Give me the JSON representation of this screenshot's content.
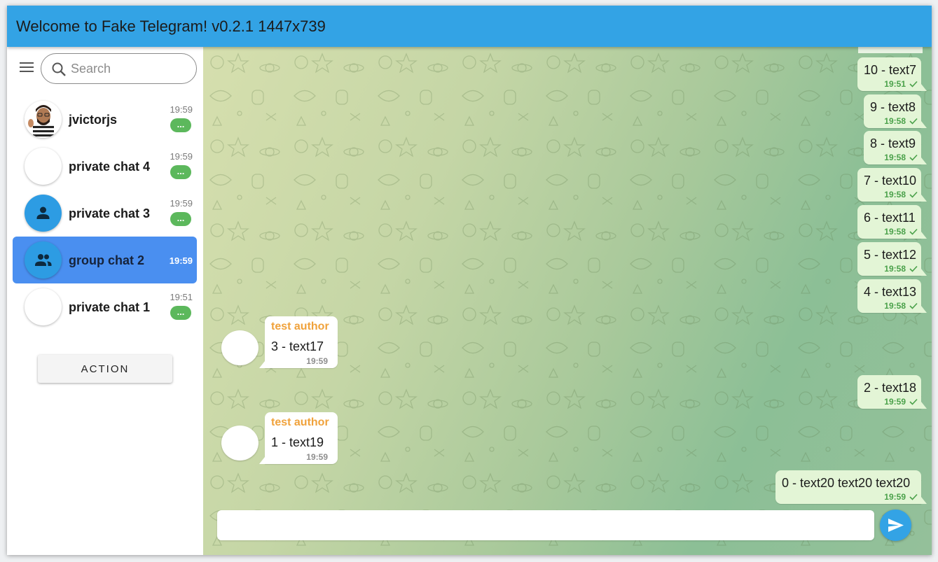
{
  "window": {
    "title": "Welcome to Fake Telegram! v0.2.1 1447x739"
  },
  "sidebar": {
    "menu_icon": "hamburger-menu-icon",
    "search": {
      "placeholder": "Search",
      "value": ""
    },
    "chats": [
      {
        "name": "jvictorjs",
        "time": "19:59",
        "badge": "...",
        "avatar": "photo",
        "active": false
      },
      {
        "name": "private chat 4",
        "time": "19:59",
        "badge": "...",
        "avatar": "blank",
        "active": false
      },
      {
        "name": "private chat 3",
        "time": "19:59",
        "badge": "...",
        "avatar": "person-icon",
        "active": false
      },
      {
        "name": "group chat 2",
        "time": "19:59",
        "badge": "",
        "avatar": "group-icon",
        "active": true
      },
      {
        "name": "private chat 1",
        "time": "19:51",
        "badge": "...",
        "avatar": "blank",
        "active": false
      }
    ],
    "action_button": "ACTION"
  },
  "messages": {
    "outgoing": [
      {
        "text": "10 - text7",
        "time": "19:51"
      },
      {
        "text": "9 - text8",
        "time": "19:58"
      },
      {
        "text": "8 - text9",
        "time": "19:58"
      },
      {
        "text": "7 - text10",
        "time": "19:58"
      },
      {
        "text": "6 - text11",
        "time": "19:58"
      },
      {
        "text": "5 - text12",
        "time": "19:58"
      },
      {
        "text": "4 - text13",
        "time": "19:58"
      },
      {
        "text": "2 - text18",
        "time": "19:59"
      },
      {
        "text": "0 - text20 text20 text20",
        "time": "19:59"
      }
    ],
    "incoming": [
      {
        "author": "test author",
        "text": "3 - text17",
        "time": "19:59"
      },
      {
        "author": "test author",
        "text": "1 - text19",
        "time": "19:59"
      }
    ]
  },
  "composer": {
    "value": "",
    "send_icon": "send-icon"
  },
  "colors": {
    "titlebar": "#33a3e5",
    "active_chat": "#4a8ff0",
    "badge": "#5cb85c",
    "outgoing_bubble": "#e3f5d6",
    "author": "#f0a23b"
  }
}
